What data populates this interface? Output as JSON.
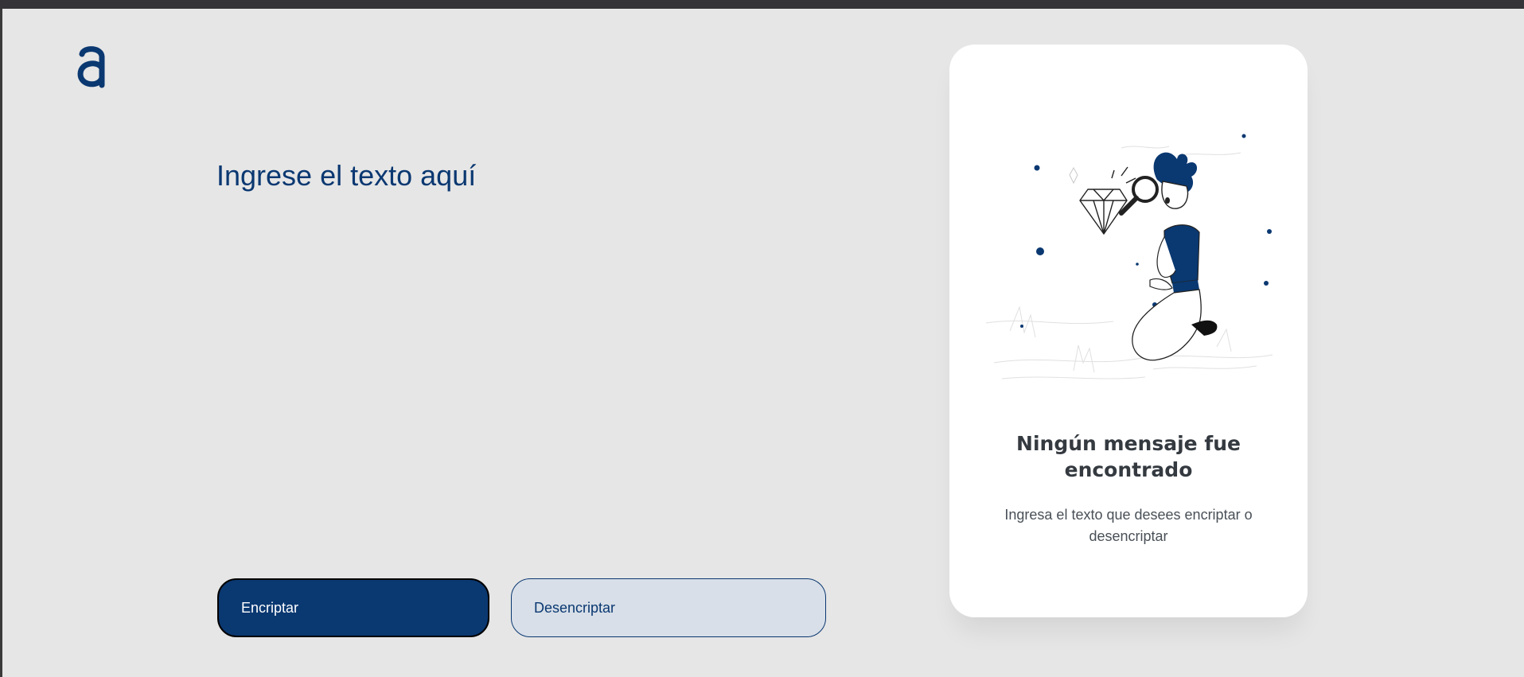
{
  "brand": {
    "logo_icon": "alura-logo-icon",
    "color": "#0a3871"
  },
  "input": {
    "placeholder": "Ingrese el texto aquí",
    "value": ""
  },
  "buttons": {
    "encrypt_label": "Encriptar",
    "decrypt_label": "Desencriptar"
  },
  "output": {
    "illustration_icon": "person-magnifier-diamond-illustration",
    "title": "Ningún mensaje fue encontrado",
    "description": "Ingresa el texto que desees encriptar o desencriptar"
  },
  "colors": {
    "background": "#e6e6e6",
    "primary": "#0a3871",
    "secondary_bg": "#d8dfe8",
    "card": "#ffffff",
    "title_text": "#343a40",
    "body_text": "#495057"
  }
}
